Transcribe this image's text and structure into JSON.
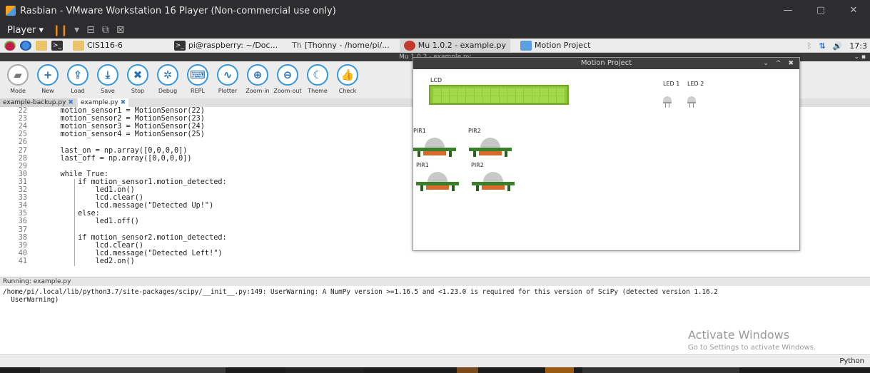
{
  "vmware": {
    "title": "Rasbian - VMware Workstation 16 Player (Non-commercial use only)",
    "player_menu": "Player",
    "win_min": "—",
    "win_max": "▢",
    "win_close": "✕"
  },
  "taskbar": {
    "items": [
      {
        "label": "CIS116-6"
      },
      {
        "label": "pi@raspberry: ~/Doc..."
      },
      {
        "label": "[Thonny - /home/pi/..."
      },
      {
        "label": "Mu 1.0.2 - example.py"
      },
      {
        "label": "Motion Project"
      }
    ],
    "clock": "17:3"
  },
  "mu": {
    "window_title": "Mu 1.0.2 - example.py",
    "toolbar": [
      {
        "label": "Mode",
        "icon": "mode-icon",
        "glyph": "▰"
      },
      {
        "label": "New",
        "icon": "plus-icon",
        "glyph": "+"
      },
      {
        "label": "Load",
        "icon": "upload-icon",
        "glyph": "⇪"
      },
      {
        "label": "Save",
        "icon": "download-icon",
        "glyph": "⤓"
      },
      {
        "label": "Stop",
        "icon": "close-icon",
        "glyph": "✖"
      },
      {
        "label": "Debug",
        "icon": "bug-icon",
        "glyph": "✲"
      },
      {
        "label": "REPL",
        "icon": "keyboard-icon",
        "glyph": "⌨"
      },
      {
        "label": "Plotter",
        "icon": "pulse-icon",
        "glyph": "∿"
      },
      {
        "label": "Zoom-in",
        "icon": "zoom-in-icon",
        "glyph": "⊕"
      },
      {
        "label": "Zoom-out",
        "icon": "zoom-out-icon",
        "glyph": "⊖"
      },
      {
        "label": "Theme",
        "icon": "moon-icon",
        "glyph": "☾"
      },
      {
        "label": "Check",
        "icon": "thumbs-up-icon",
        "glyph": "👍"
      }
    ],
    "tabs": [
      {
        "label": "example-backup.py",
        "close": "✖"
      },
      {
        "label": "example.py",
        "close": "✖"
      }
    ],
    "code_lines": [
      {
        "n": "22",
        "code": "    motion_sensor1 = MotionSensor(22)"
      },
      {
        "n": "23",
        "code": "    motion_sensor2 = MotionSensor(23)"
      },
      {
        "n": "24",
        "code": "    motion_sensor3 = MotionSensor(24)"
      },
      {
        "n": "25",
        "code": "    motion_sensor4 = MotionSensor(25)"
      },
      {
        "n": "26",
        "code": ""
      },
      {
        "n": "27",
        "code": "    last_on = np.array([0,0,0,0])"
      },
      {
        "n": "28",
        "code": "    last_off = np.array([0,0,0,0])"
      },
      {
        "n": "29",
        "code": ""
      },
      {
        "n": "30",
        "code": "    while True:"
      },
      {
        "n": "31",
        "code": "        if motion_sensor1.motion_detected:"
      },
      {
        "n": "32",
        "code": "            led1.on()"
      },
      {
        "n": "33",
        "code": "            lcd.clear()"
      },
      {
        "n": "34",
        "code": "            lcd.message(\"Detected Up!\")"
      },
      {
        "n": "35",
        "code": "        else:"
      },
      {
        "n": "36",
        "code": "            led1.off()"
      },
      {
        "n": "37",
        "code": ""
      },
      {
        "n": "38",
        "code": "        if motion_sensor2.motion_detected:"
      },
      {
        "n": "39",
        "code": "            lcd.clear()"
      },
      {
        "n": "40",
        "code": "            lcd.message(\"Detected Left!\")"
      },
      {
        "n": "41",
        "code": "            led2.on()"
      }
    ],
    "running_label": "Running: example.py",
    "output_lines": [
      "/home/pi/.local/lib/python3.7/site-packages/scipy/__init__.py:149: UserWarning: A NumPy version >=1.16.5 and <1.23.0 is required for this version of SciPy (detected version 1.16.2",
      "  UserWarning)"
    ],
    "status_mode": "Python"
  },
  "motion_project": {
    "title": "Motion Project",
    "lcd_label": "LCD",
    "led1_label": "LED 1",
    "led2_label": "LED 2",
    "pir_labels": [
      "PIR1",
      "PIR2",
      "PIR1",
      "PIR2"
    ],
    "ctrl_min": "⌄",
    "ctrl_max": "^",
    "ctrl_close": "✖"
  },
  "activate": {
    "title": "Activate Windows",
    "subtitle": "Go to Settings to activate Windows."
  },
  "colors": {
    "accent": "#3498db",
    "lcd_green": "#8fc93a",
    "pir_board": "#3b7f2b"
  }
}
